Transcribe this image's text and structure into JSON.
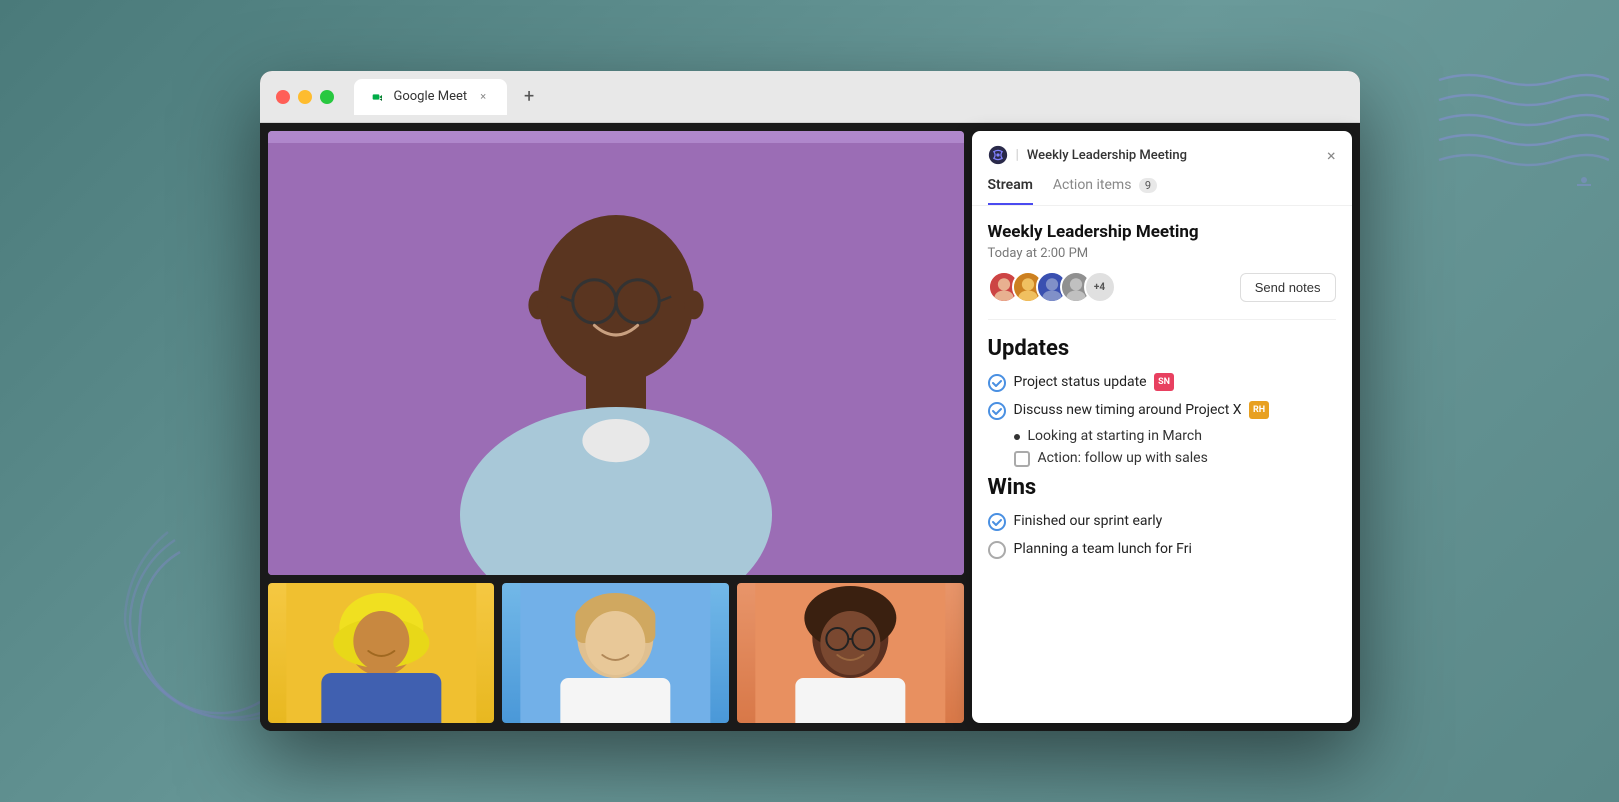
{
  "browser": {
    "tab_title": "Google Meet",
    "tab_close_label": "×",
    "tab_new_label": "+"
  },
  "traffic_lights": {
    "red": "#ff5f57",
    "yellow": "#febc2e",
    "green": "#28c840"
  },
  "notes_panel": {
    "logo_alt": "notes-logo",
    "pipe": "|",
    "meeting_title": "Weekly Leadership Meeting",
    "close_label": "×",
    "tabs": [
      {
        "label": "Stream",
        "active": true
      },
      {
        "label": "Action items",
        "active": false,
        "badge": "9"
      }
    ],
    "meeting_name": "Weekly Leadership Meeting",
    "meeting_time": "Today at 2:00 PM",
    "attendees_more": "+4",
    "send_notes_label": "Send notes",
    "sections": [
      {
        "title": "Updates",
        "items": [
          {
            "type": "check-filled",
            "text": "Project status update",
            "badge": "SN",
            "badge_class": "badge-sn"
          },
          {
            "type": "check-filled",
            "text": "Discuss new timing around Project X",
            "badge": "RH",
            "badge_class": "badge-rh"
          },
          {
            "type": "bullet",
            "text": "Looking at starting in March"
          },
          {
            "type": "checkbox",
            "text": "Action: follow up with sales"
          }
        ]
      },
      {
        "title": "Wins",
        "items": [
          {
            "type": "check-filled",
            "text": "Finished our sprint early"
          },
          {
            "type": "check-empty",
            "text": "Planning a team lunch for Fri"
          }
        ]
      }
    ]
  },
  "decorations": {
    "wave_color": "#8090cc",
    "circle_color": "#7888bb"
  }
}
